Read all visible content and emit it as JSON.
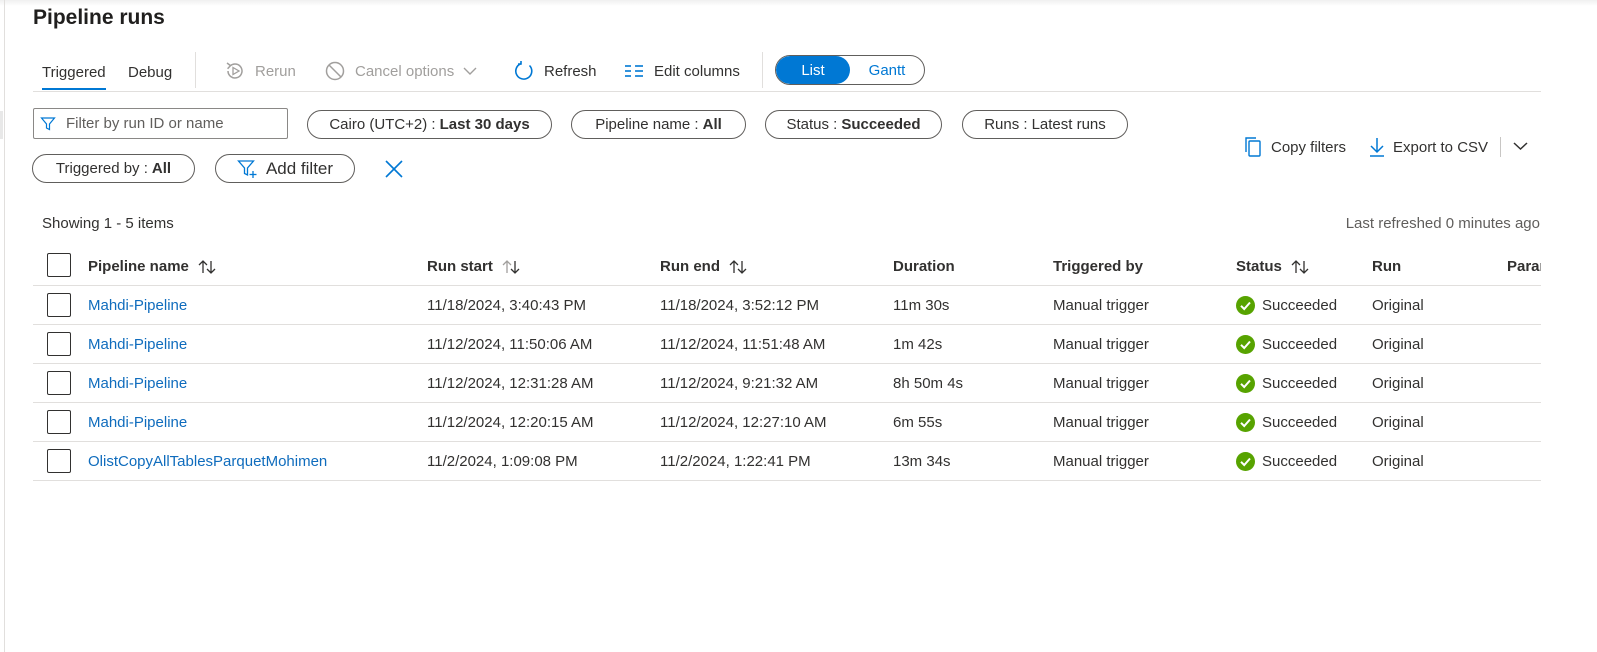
{
  "page": {
    "title": "Pipeline runs"
  },
  "tabs": [
    {
      "label": "Triggered",
      "active": true
    },
    {
      "label": "Debug",
      "active": false
    }
  ],
  "toolbar": {
    "rerun": "Rerun",
    "cancel_options": "Cancel options",
    "refresh": "Refresh",
    "edit_columns": "Edit columns",
    "view_toggle": {
      "list": "List",
      "gantt": "Gantt",
      "selected": "List"
    }
  },
  "filters": {
    "search_placeholder": "Filter by run ID or name",
    "timezone": {
      "label": "Cairo (UTC+2) :",
      "value": "Last 30 days"
    },
    "pipeline_name": {
      "label": "Pipeline name :",
      "value": "All"
    },
    "status": {
      "label": "Status :",
      "value": "Succeeded"
    },
    "runs": {
      "label": "Runs :",
      "value": "Latest runs"
    },
    "triggered_by": {
      "label": "Triggered by :",
      "value": "All"
    },
    "add_filter": "Add filter"
  },
  "actions": {
    "copy_filters": "Copy filters",
    "export_csv": "Export to CSV"
  },
  "summary": {
    "showing": "Showing 1 - 5 items",
    "last_refreshed": "Last refreshed 0 minutes ago"
  },
  "table": {
    "columns": {
      "pipeline_name": "Pipeline name",
      "run_start": "Run start",
      "run_end": "Run end",
      "duration": "Duration",
      "triggered_by": "Triggered by",
      "status": "Status",
      "run": "Run",
      "parameters": "Parar"
    },
    "rows": [
      {
        "name": "Mahdi-Pipeline",
        "start": "11/18/2024, 3:40:43 PM",
        "end": "11/18/2024, 3:52:12 PM",
        "duration": "11m 30s",
        "triggered_by": "Manual trigger",
        "status": "Succeeded",
        "run": "Original"
      },
      {
        "name": "Mahdi-Pipeline",
        "start": "11/12/2024, 11:50:06 AM",
        "end": "11/12/2024, 11:51:48 AM",
        "duration": "1m 42s",
        "triggered_by": "Manual trigger",
        "status": "Succeeded",
        "run": "Original"
      },
      {
        "name": "Mahdi-Pipeline",
        "start": "11/12/2024, 12:31:28 AM",
        "end": "11/12/2024, 9:21:32 AM",
        "duration": "8h 50m 4s",
        "triggered_by": "Manual trigger",
        "status": "Succeeded",
        "run": "Original"
      },
      {
        "name": "Mahdi-Pipeline",
        "start": "11/12/2024, 12:20:15 AM",
        "end": "11/12/2024, 12:27:10 AM",
        "duration": "6m 55s",
        "triggered_by": "Manual trigger",
        "status": "Succeeded",
        "run": "Original"
      },
      {
        "name": "OlistCopyAllTablesParquetMohimen",
        "start": "11/2/2024, 1:09:08 PM",
        "end": "11/2/2024, 1:22:41 PM",
        "duration": "13m 34s",
        "triggered_by": "Manual trigger",
        "status": "Succeeded",
        "run": "Original"
      }
    ]
  },
  "colors": {
    "accent": "#0078d4",
    "link": "#0f6cbd",
    "success": "#57a300",
    "text": "#323130",
    "disabled": "#a19f9d"
  },
  "icons": [
    "rerun-icon",
    "cancel-icon",
    "chevron-down-icon",
    "refresh-icon",
    "edit-columns-icon",
    "filter-icon",
    "add-filter-icon",
    "close-icon",
    "copy-icon",
    "download-icon",
    "sort-icon",
    "success-check-icon"
  ]
}
